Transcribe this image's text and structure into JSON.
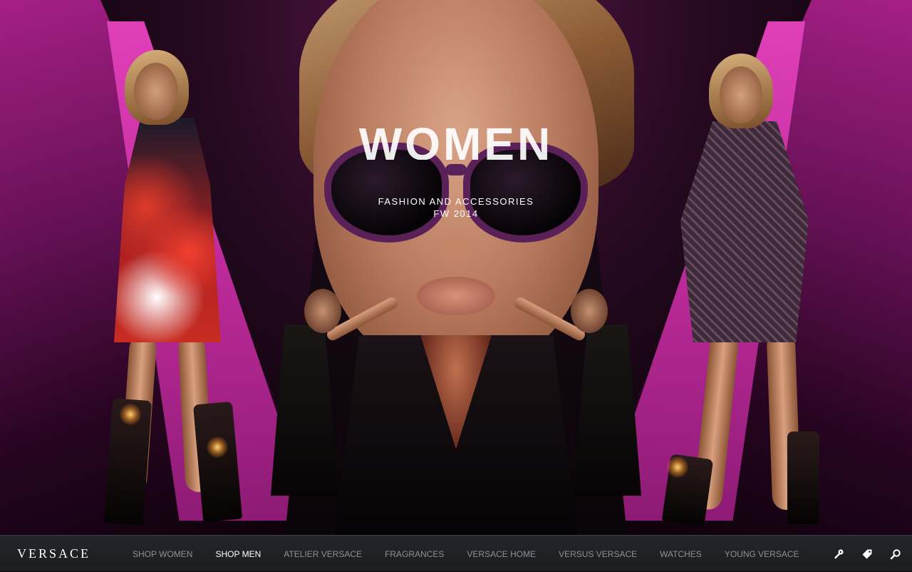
{
  "hero": {
    "headline": "WOMEN",
    "subtitle_line1": "FASHION AND ACCESSORIES",
    "subtitle_line2": "FW 2014"
  },
  "navbar": {
    "logo": "VERSACE",
    "items": [
      {
        "label": "SHOP WOMEN",
        "active": false
      },
      {
        "label": "SHOP MEN",
        "active": true
      },
      {
        "label": "ATELIER VERSACE",
        "active": false
      },
      {
        "label": "FRAGRANCES",
        "active": false
      },
      {
        "label": "VERSACE HOME",
        "active": false
      },
      {
        "label": "VERSUS VERSACE",
        "active": false
      },
      {
        "label": "WATCHES",
        "active": false
      },
      {
        "label": "YOUNG VERSACE",
        "active": false
      }
    ],
    "icons": [
      "key-icon",
      "tag-icon",
      "search-icon"
    ]
  },
  "colors": {
    "accent_magenta": "#c22c9e",
    "navbar_bg": "#1f2124",
    "nav_text": "#8d9197",
    "nav_text_active": "#ffffff"
  }
}
